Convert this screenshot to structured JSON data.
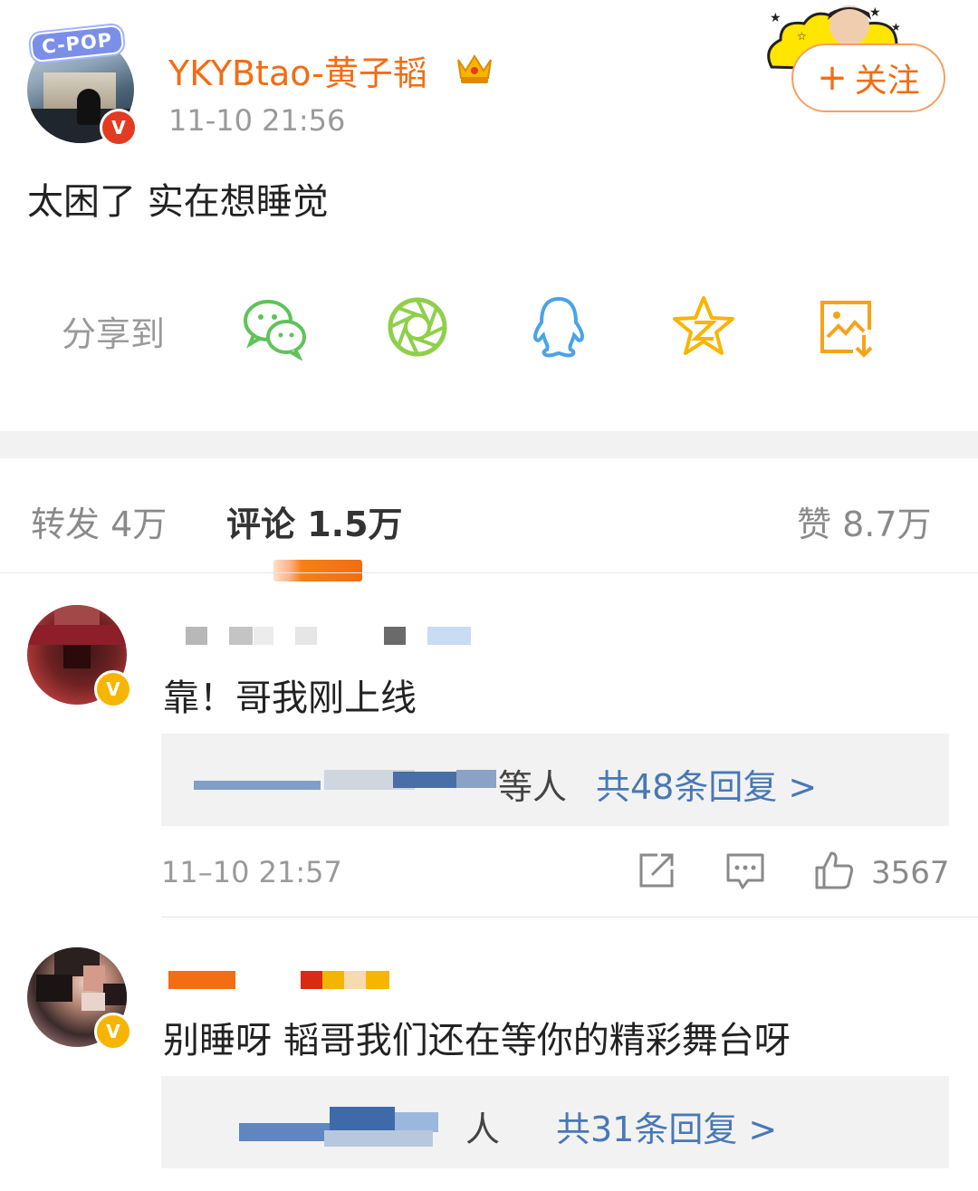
{
  "post": {
    "avatar_tag": "C-POP",
    "username": "YKYBtao-黄子韬",
    "timestamp": "11-10 21:56",
    "verified_badge": "V",
    "follow_label": "关注",
    "follow_plus": "+",
    "text": "太困了 实在想睡觉"
  },
  "share": {
    "label": "分享到",
    "targets": [
      "wechat-icon",
      "moments-icon",
      "qq-icon",
      "qzone-icon",
      "save-image-icon"
    ]
  },
  "tabs": {
    "repost": "转发 4万",
    "comments": "评论 1.5万",
    "likes": "赞 8.7万"
  },
  "comments": [
    {
      "text": "靠！哥我刚上线",
      "reply_suffix": "等人",
      "reply_count": "共48条回复 >",
      "time": "11–10 21:57",
      "likes": "3567",
      "badge": "V"
    },
    {
      "text": "别睡呀 韬哥我们还在等你的精彩舞台呀",
      "reply_suffix": "人",
      "reply_count": "共31条回复 >",
      "badge": "V"
    }
  ],
  "colors": {
    "accent": "#f26d13",
    "link": "#4878b6",
    "muted": "#9a9a9a",
    "verified_red": "#e23b22",
    "verified_gold": "#f7b500"
  }
}
